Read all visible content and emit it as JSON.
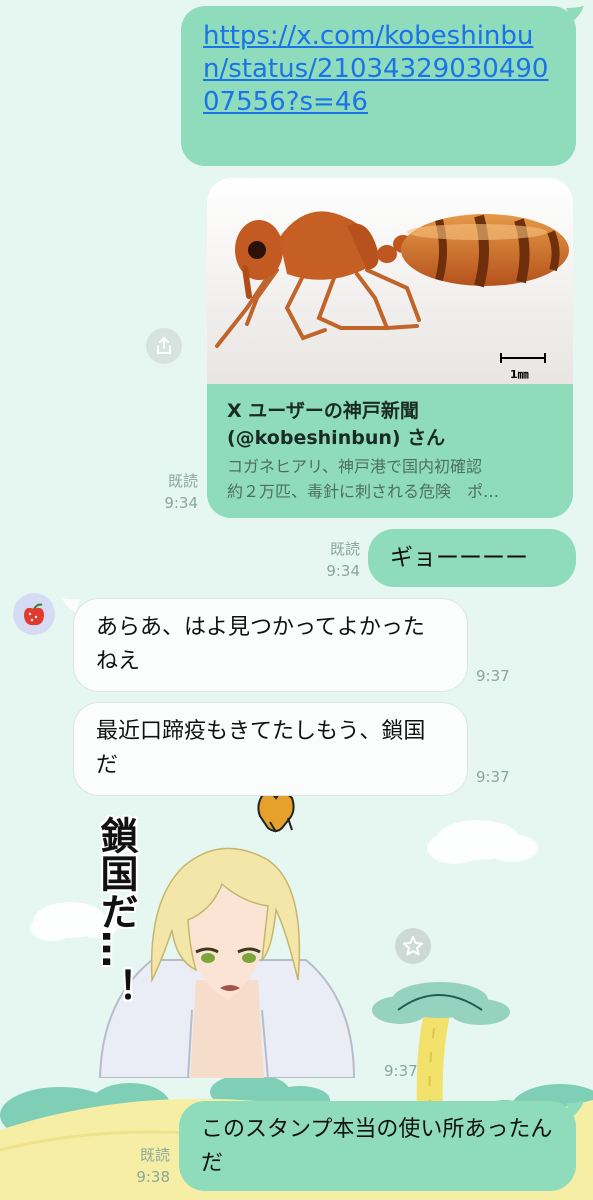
{
  "messages": {
    "link_url": "https://x.com/kobeshinbun/status/2103432903049007556?s=46",
    "card": {
      "scale_label": "1㎜",
      "title": "X ユーザーの神戸新聞 (@kobeshinbun) さん",
      "desc_line1": "コガネヒアリ、神戸港で国内初確認",
      "desc_line2": "約２万匹、毒針に刺される危険　ポ…",
      "read": "既読",
      "time": "9:34"
    },
    "outgoing_1": {
      "text": "ギョーーーー",
      "read": "既読",
      "time": "9:34"
    },
    "incoming_1": {
      "text": "あらあ、はよ見つかってよかったねえ",
      "time": "9:37"
    },
    "incoming_2": {
      "text": "最近口蹄疫もきてたしもう、鎖国だ",
      "time": "9:37"
    },
    "sticker": {
      "caption": "鎖国だ…！",
      "time": "9:37"
    },
    "outgoing_2": {
      "text": "このスタンプ本当の使い所あったんだ",
      "read": "既読",
      "time": "9:38"
    }
  },
  "icons": {
    "share": "share-icon",
    "favorite": "star-icon",
    "avatar": "apple-icon"
  },
  "colors": {
    "background": "#e6f6f1",
    "outgoing_bubble": "#8fdcbc",
    "incoming_bubble": "#fbfdfc",
    "link": "#1a73e8"
  }
}
